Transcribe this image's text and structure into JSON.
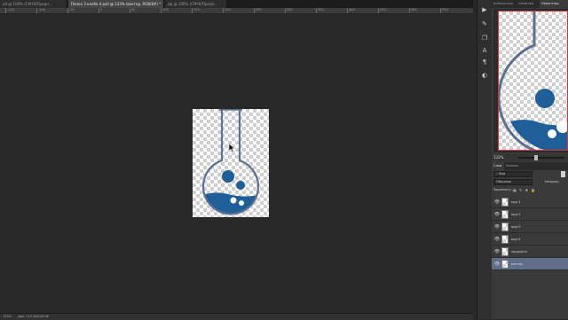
{
  "tabs": [
    {
      "label": "od @ 100% (CMYK/Предп...",
      "active": false
    },
    {
      "label": "Папка 3 колба 4.psd @ 133% (вектор, RGB/8#) *",
      "active": true
    },
    {
      "label": "ид @ 100% (CMYK/Предп...",
      "active": false
    }
  ],
  "ruler_labels": [
    "-150",
    "-100",
    "-50",
    "0",
    "50",
    "100",
    "150",
    "200",
    "250",
    "300",
    "350",
    "400",
    "450",
    "500",
    "550"
  ],
  "status": {
    "text": "Док: 127,4K/228,9K"
  },
  "right_panel": {
    "top_tabs": [
      "Библиотеки",
      "Свойства",
      "Навигатор"
    ],
    "zoom_value": "132%",
    "layers_tabs": [
      "Слои",
      "Каналы"
    ],
    "kind_label": "Вид",
    "blend_mode": "Обычные",
    "opacity_label": "Непрозр.",
    "lock_label": "Закрепить:",
    "layers": [
      {
        "name": "круг1",
        "selected": false
      },
      {
        "name": "круг2",
        "selected": false
      },
      {
        "name": "круг3",
        "selected": false
      },
      {
        "name": "круг4",
        "selected": false
      },
      {
        "name": "жидкость",
        "selected": false
      },
      {
        "name": "вектор",
        "selected": true
      }
    ]
  },
  "colors": {
    "flask_outline": "#5b6f93",
    "liquid": "#1f5f99",
    "selection": "#5f6f8a"
  }
}
